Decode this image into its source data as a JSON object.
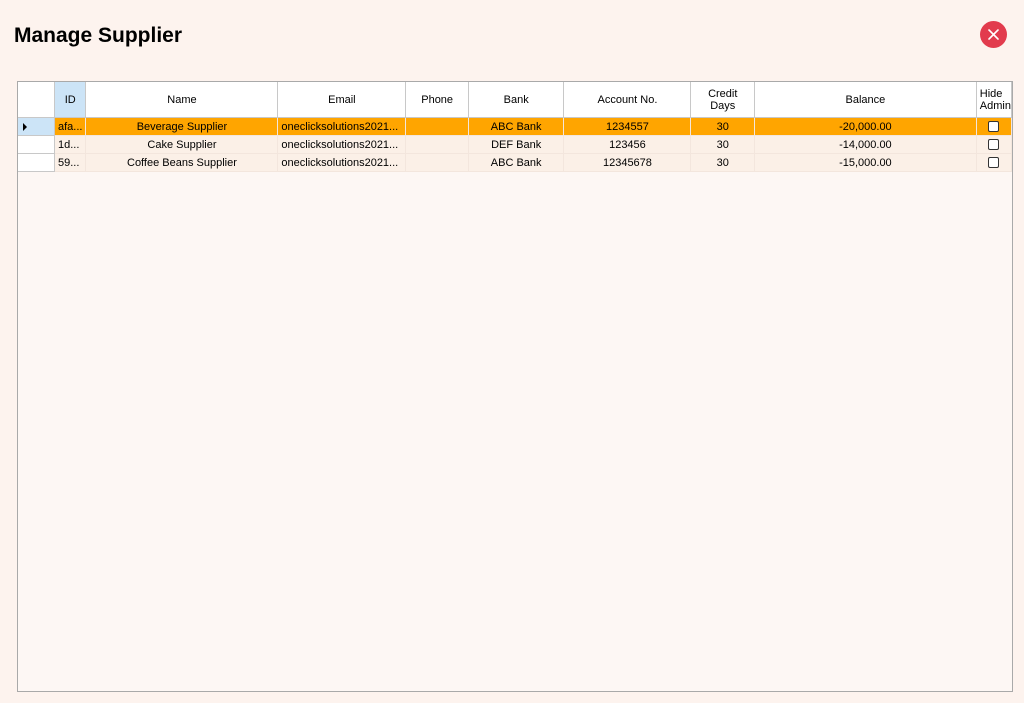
{
  "window": {
    "title": "Manage Supplier",
    "close_icon": "close-icon"
  },
  "colors": {
    "selected_row": "#ffa500",
    "close_button": "#e23b4d",
    "header_selected": "#cce4f7",
    "background": "#fdf3ee"
  },
  "grid": {
    "columns": {
      "id": "ID",
      "name": "Name",
      "email": "Email",
      "phone": "Phone",
      "bank": "Bank",
      "account": "Account No.",
      "credit_line1": "Credit",
      "credit_line2": "Days",
      "balance": "Balance",
      "hide_line1": "Hide",
      "hide_line2": "Admin"
    },
    "rows": [
      {
        "id": "afa...",
        "name": "Beverage Supplier",
        "email": "oneclicksolutions2021...",
        "phone": "",
        "bank": "ABC Bank",
        "account": "1234557",
        "credit_days": "30",
        "balance": "-20,000.00",
        "hide_admin": false,
        "selected": true
      },
      {
        "id": "1d...",
        "name": "Cake Supplier",
        "email": "oneclicksolutions2021...",
        "phone": "",
        "bank": "DEF Bank",
        "account": "123456",
        "credit_days": "30",
        "balance": "-14,000.00",
        "hide_admin": false,
        "selected": false
      },
      {
        "id": "59...",
        "name": "Coffee Beans Supplier",
        "email": "oneclicksolutions2021...",
        "phone": "",
        "bank": "ABC Bank",
        "account": "12345678",
        "credit_days": "30",
        "balance": "-15,000.00",
        "hide_admin": false,
        "selected": false
      }
    ]
  }
}
